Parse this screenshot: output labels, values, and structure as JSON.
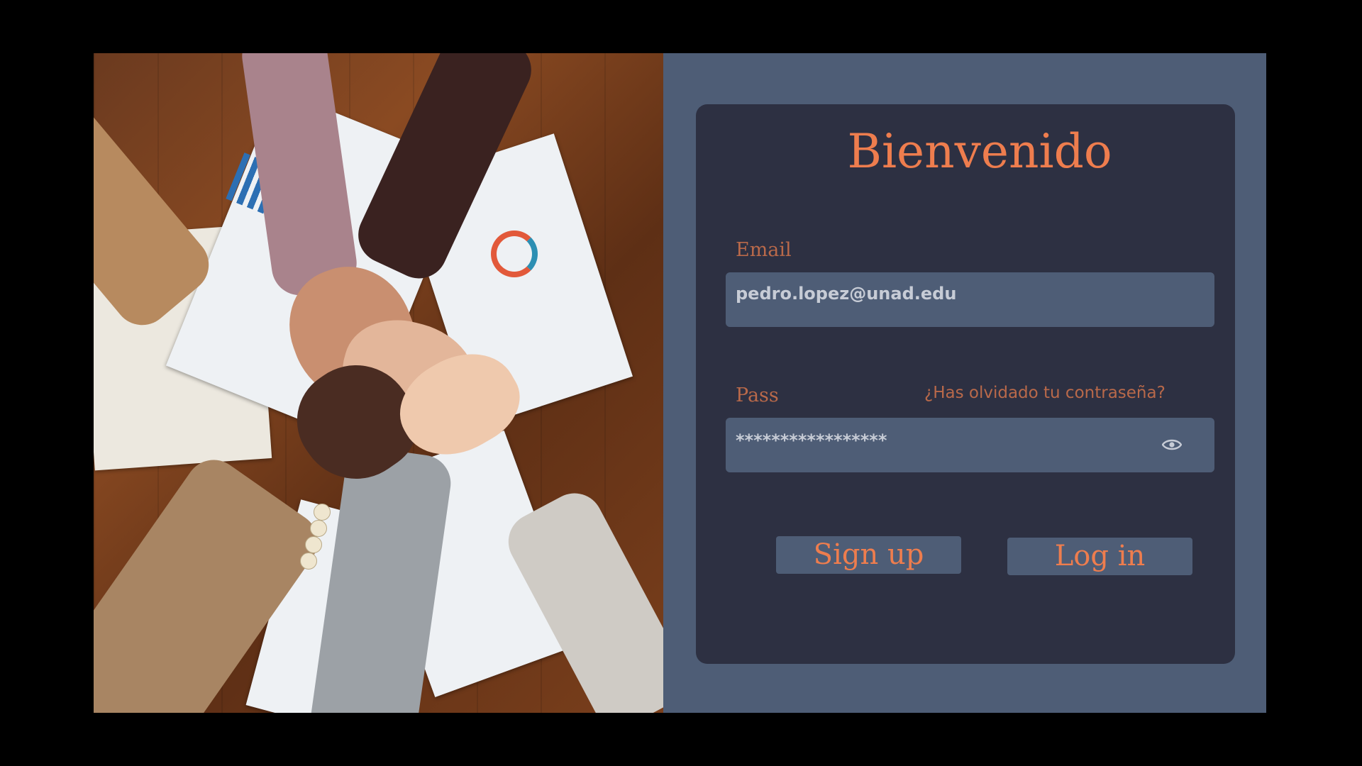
{
  "colors": {
    "page_background": "#000000",
    "panel_background": "#4e5d76",
    "card_background": "#2d3042",
    "accent": "#ee7d4e",
    "label": "#b9694a",
    "field_text": "#c7ccd6"
  },
  "hero": {
    "description_icon": "teamwork-photo"
  },
  "login": {
    "title": "Bienvenido",
    "email": {
      "label": "Email",
      "value": "pedro.lopez@unad.edu"
    },
    "password": {
      "label": "Pass",
      "value": "*****************",
      "toggle_icon": "eye-icon",
      "forgot_link": "¿Has olvidado tu contraseña?"
    },
    "buttons": {
      "signup": "Sign up",
      "login": "Log in"
    }
  }
}
